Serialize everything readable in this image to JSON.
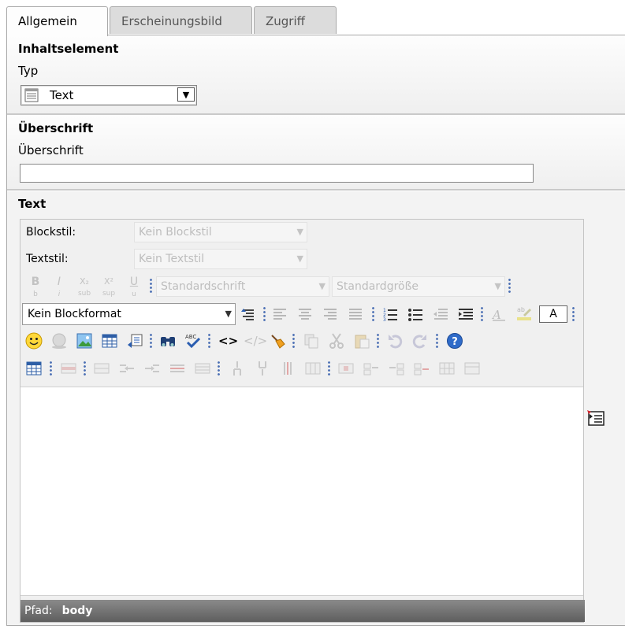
{
  "tabs": [
    {
      "label": "Allgemein",
      "active": true
    },
    {
      "label": "Erscheinungsbild",
      "active": false
    },
    {
      "label": "Zugriff",
      "active": false
    }
  ],
  "content_element": {
    "section_title": "Inhaltselement",
    "type_label": "Typ",
    "type_value": "Text",
    "type_icon": "text-element-icon"
  },
  "header": {
    "section_title": "Überschrift",
    "field_label": "Überschrift",
    "field_value": ""
  },
  "text": {
    "section_title": "Text",
    "blockstyle_label": "Blockstil:",
    "blockstyle_value": "Kein Blockstil",
    "textstyle_label": "Textstil:",
    "textstyle_value": "Kein Textstil",
    "font_value": "Standardschrift",
    "size_value": "Standardgröße",
    "blockformat_value": "Kein Blockformat",
    "format_buttons": [
      {
        "glyph": "B",
        "sub": "b"
      },
      {
        "glyph": "I",
        "sub": "i"
      },
      {
        "glyph": "X₂",
        "sub": "sub"
      },
      {
        "glyph": "X²",
        "sub": "sup"
      },
      {
        "glyph": "U",
        "sub": "u"
      }
    ],
    "text_color_label": "A",
    "status_path_label": "Pfad:",
    "status_path_value": "body"
  },
  "colors": {
    "tab_inactive_bg": "#dcdcdc",
    "statusbar_bg": "#6e6e6e",
    "separator_dots": "#4b6fb4"
  }
}
